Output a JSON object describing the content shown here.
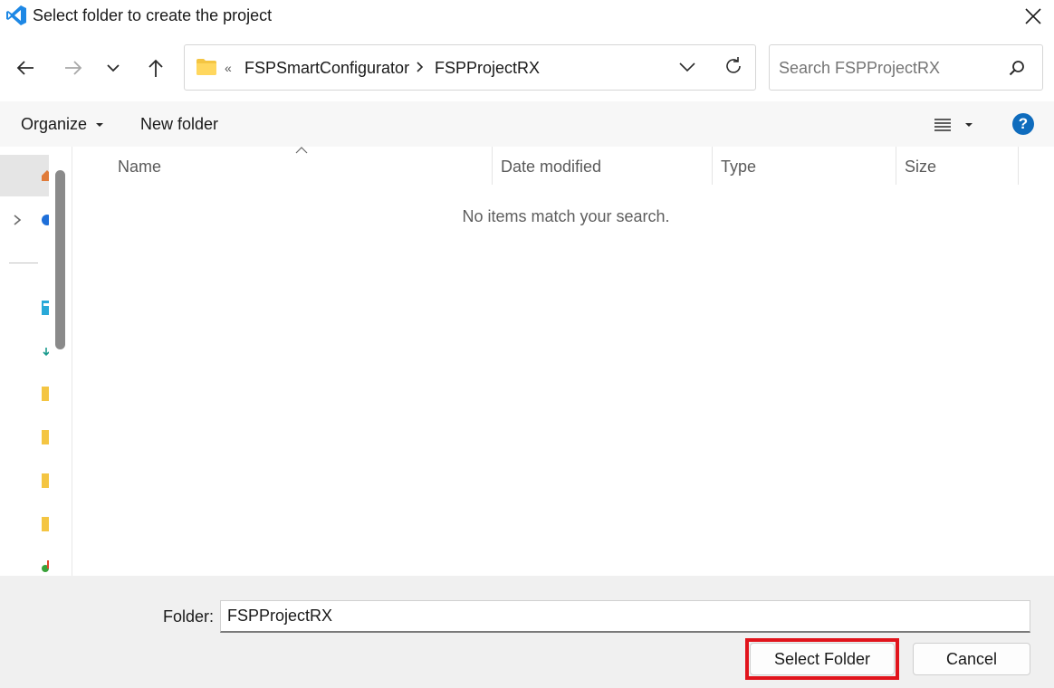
{
  "window": {
    "title": "Select folder to create the project"
  },
  "address": {
    "overflow": "«",
    "crumbs": [
      "FSPSmartConfigurator",
      "FSPProjectRX"
    ]
  },
  "search": {
    "placeholder": "Search FSPProjectRX"
  },
  "toolbar": {
    "organize_label": "Organize",
    "new_folder_label": "New folder",
    "help_glyph": "?"
  },
  "columns": {
    "name": "Name",
    "date_modified": "Date modified",
    "type": "Type",
    "size": "Size"
  },
  "file_list": {
    "empty_message": "No items match your search."
  },
  "footer": {
    "folder_label": "Folder:",
    "folder_value": "FSPProjectRX",
    "select_button": "Select Folder",
    "cancel_button": "Cancel"
  },
  "colors": {
    "accent": "#0f6cbd",
    "highlight": "#e1141c",
    "folder": "#f4c542"
  },
  "icons": [
    "vscode-icon",
    "close-icon",
    "back-arrow-icon",
    "forward-arrow-icon",
    "chevron-down-icon",
    "up-arrow-icon",
    "folder-icon",
    "refresh-icon",
    "search-icon",
    "list-view-icon",
    "help-icon",
    "sort-ascending-icon"
  ]
}
